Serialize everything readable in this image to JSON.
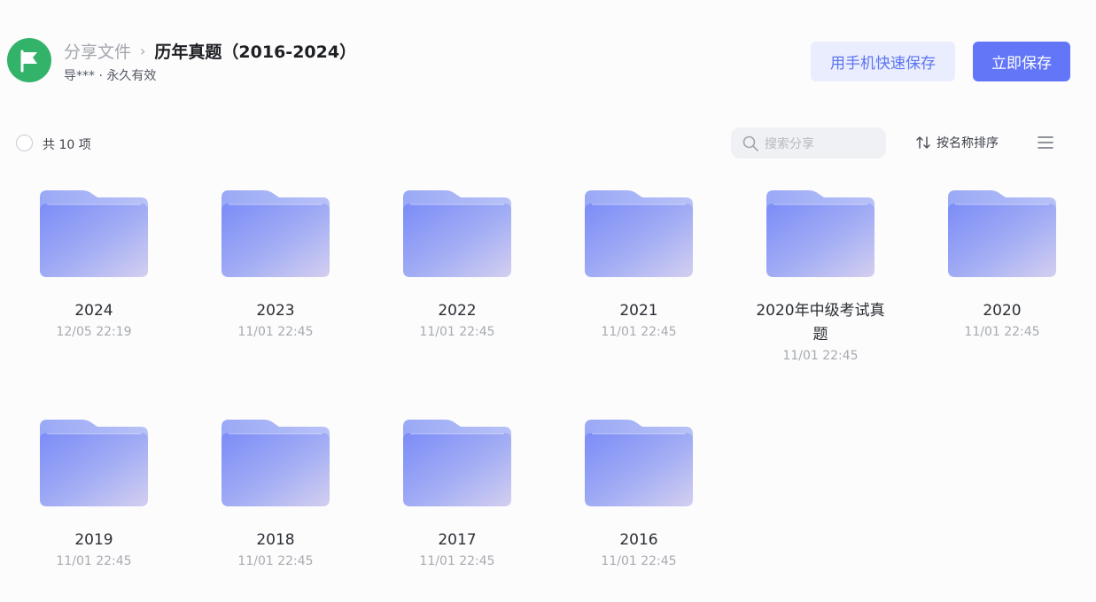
{
  "header": {
    "breadcrumb_root": "分享文件",
    "breadcrumb_separator": "›",
    "title": "历年真题（2016-2024）",
    "meta": "导*** · 永久有效",
    "brand_color": "#33b36a"
  },
  "actions": {
    "save_via_phone": "用手机快速保存",
    "save_now": "立即保存",
    "accent_color": "#6276f7"
  },
  "toolbar": {
    "count": "共 10 项",
    "search_placeholder": "搜索分享",
    "sort_label": "按名称排序"
  },
  "folders": [
    {
      "name": "2024",
      "date": "12/05 22:19"
    },
    {
      "name": "2023",
      "date": "11/01 22:45"
    },
    {
      "name": "2022",
      "date": "11/01 22:45"
    },
    {
      "name": "2021",
      "date": "11/01 22:45"
    },
    {
      "name": "2020年中级考试真题",
      "date": "11/01 22:45"
    },
    {
      "name": "2020",
      "date": "11/01 22:45"
    },
    {
      "name": "2019",
      "date": "11/01 22:45"
    },
    {
      "name": "2018",
      "date": "11/01 22:45"
    },
    {
      "name": "2017",
      "date": "11/01 22:45"
    },
    {
      "name": "2016",
      "date": "11/01 22:45"
    }
  ]
}
